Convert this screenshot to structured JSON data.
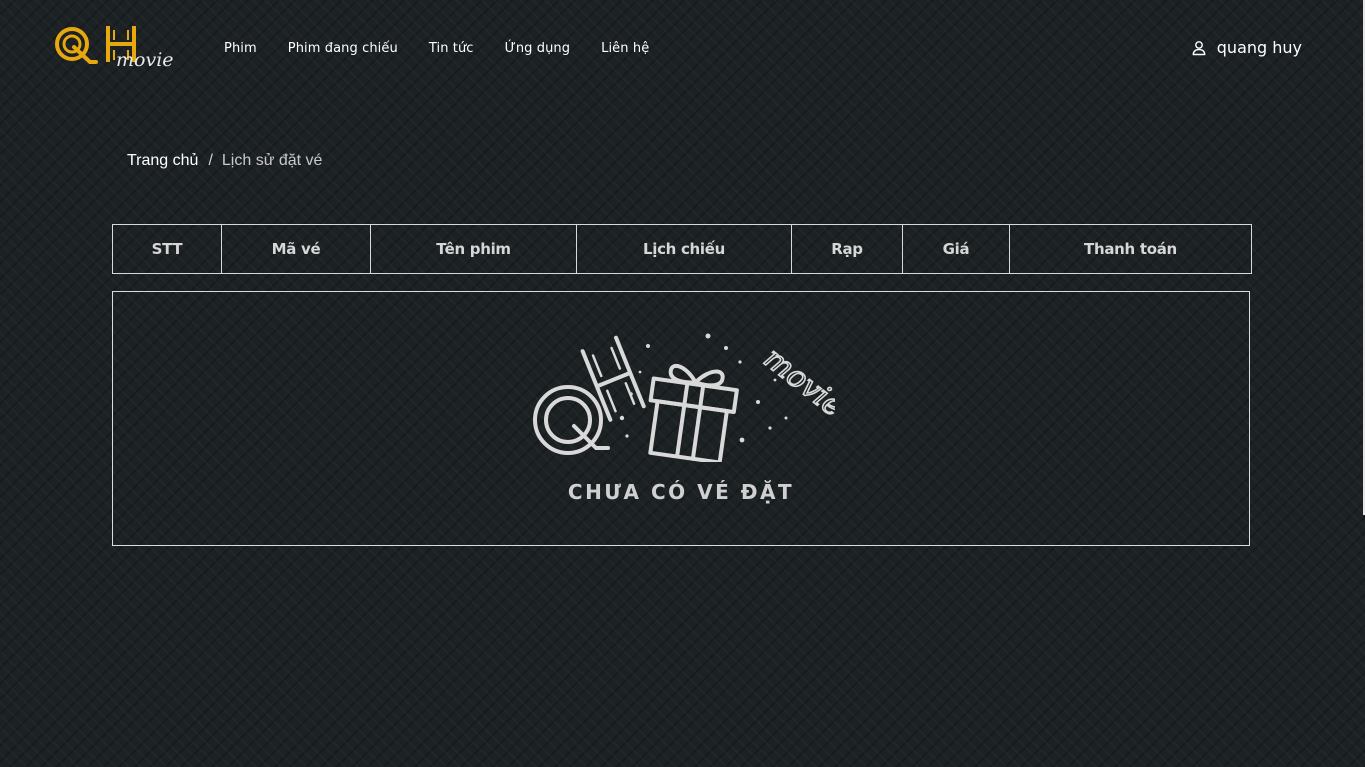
{
  "brand": {
    "logo_text": "QH movie",
    "accent_color": "#e7a70f"
  },
  "nav": {
    "items": [
      {
        "label": "Phim"
      },
      {
        "label": "Phim đang chiếu"
      },
      {
        "label": "Tin tức"
      },
      {
        "label": "Ứng dụng"
      },
      {
        "label": "Liên hệ"
      }
    ]
  },
  "user": {
    "icon": "user-icon",
    "name": "quang huy"
  },
  "breadcrumb": {
    "home": "Trang chủ",
    "separator": "/",
    "current": "Lịch sử đặt vé"
  },
  "table": {
    "columns": [
      "STT",
      "Mã vé",
      "Tên phim",
      "Lịch chiếu",
      "Rạp",
      "Giá",
      "Thanh toán"
    ]
  },
  "empty_state": {
    "illustration": "gift-box-icon",
    "illustration_text": "QH movie",
    "message": "CHƯA CÓ VÉ ĐẶT"
  }
}
